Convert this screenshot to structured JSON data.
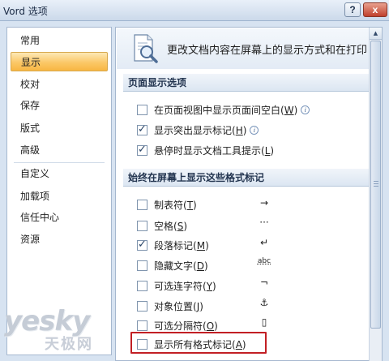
{
  "window": {
    "title": "Vord 选项",
    "help_button": "?",
    "close_button": "x"
  },
  "nav": {
    "items": [
      {
        "label": "常用"
      },
      {
        "label": "显示"
      },
      {
        "label": "校对"
      },
      {
        "label": "保存"
      },
      {
        "label": "版式"
      },
      {
        "label": "高级"
      },
      {
        "label": "自定义"
      },
      {
        "label": "加载项"
      },
      {
        "label": "信任中心"
      },
      {
        "label": "资源"
      }
    ],
    "selected": "显示"
  },
  "panel": {
    "header_text": "更改文档内容在屏幕上的显示方式和在打印",
    "header_icon": "magnifier-document-icon",
    "page_section": {
      "title": "页面显示选项",
      "options": [
        {
          "label": "在页面视图中显示页面间空白",
          "hotkey": "W",
          "checked": false,
          "info": true
        },
        {
          "label": "显示突出显示标记",
          "hotkey": "H",
          "checked": true,
          "info": true
        },
        {
          "label": "悬停时显示文档工具提示",
          "hotkey": "L",
          "checked": true,
          "info": false
        }
      ]
    },
    "marks_section": {
      "title": "始终在屏幕上显示这些格式标记",
      "options": [
        {
          "label": "制表符",
          "hotkey": "T",
          "checked": false,
          "symbol": "→"
        },
        {
          "label": "空格",
          "hotkey": "S",
          "checked": false,
          "symbol": "···"
        },
        {
          "label": "段落标记",
          "hotkey": "M",
          "checked": true,
          "symbol": "↵"
        },
        {
          "label": "隐藏文字",
          "hotkey": "D",
          "checked": false,
          "symbol": "abc"
        },
        {
          "label": "可选连字符",
          "hotkey": "Y",
          "checked": false,
          "symbol": "¬"
        },
        {
          "label": "对象位置",
          "hotkey": "J",
          "checked": false,
          "symbol": "⚓"
        },
        {
          "label": "可选分隔符",
          "hotkey": "O",
          "checked": false,
          "symbol": "▯"
        },
        {
          "label": "显示所有格式标记",
          "hotkey": "A",
          "checked": false,
          "symbol": ""
        }
      ]
    }
  },
  "watermark": {
    "brand": "yesky",
    "sub": "天极网"
  },
  "colors": {
    "selected_nav": "#fbc867",
    "highlight_box": "#c21f24",
    "section_title": "#22344f"
  }
}
